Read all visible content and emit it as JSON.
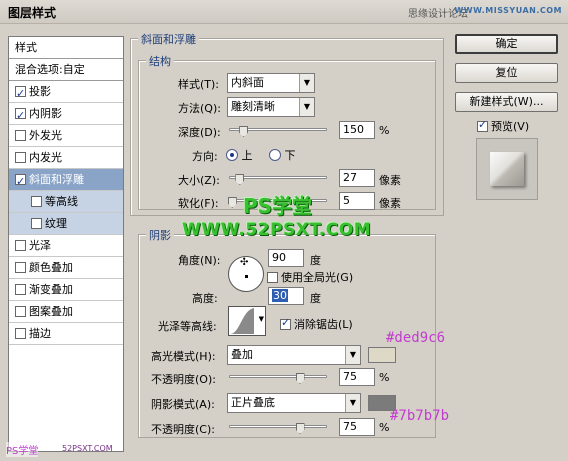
{
  "window": {
    "title": "图层样式",
    "watermark_top": "思缘设计论坛",
    "watermark_top_site": "WWW.MISSYUAN.COM"
  },
  "styles_list": {
    "header": "样式",
    "blend_options": "混合选项:自定",
    "items": [
      {
        "label": "投影",
        "checked": true
      },
      {
        "label": "内阴影",
        "checked": true
      },
      {
        "label": "外发光",
        "checked": false
      },
      {
        "label": "内发光",
        "checked": false
      },
      {
        "label": "斜面和浮雕",
        "checked": true,
        "selected": true
      },
      {
        "label": "等高线",
        "checked": false,
        "sub": true
      },
      {
        "label": "纹理",
        "checked": false,
        "sub": true
      },
      {
        "label": "光泽",
        "checked": false
      },
      {
        "label": "颜色叠加",
        "checked": false
      },
      {
        "label": "渐变叠加",
        "checked": false
      },
      {
        "label": "图案叠加",
        "checked": false
      },
      {
        "label": "描边",
        "checked": false
      }
    ]
  },
  "bevel": {
    "section_title": "斜面和浮雕",
    "structure_title": "结构",
    "style_label": "样式(T):",
    "style_value": "内斜面",
    "technique_label": "方法(Q):",
    "technique_value": "雕刻清晰",
    "depth_label": "深度(D):",
    "depth_value": "150",
    "depth_unit": "%",
    "depth_fraction": 0.15,
    "direction_label": "方向:",
    "direction_up": "上",
    "direction_down": "下",
    "size_label": "大小(Z):",
    "size_value": "27",
    "size_unit": "像素",
    "size_fraction": 0.11,
    "soften_label": "软化(F):",
    "soften_value": "5",
    "soften_unit": "像素",
    "soften_fraction": 0.03
  },
  "shading": {
    "title": "阴影",
    "angle_label": "角度(N):",
    "angle_value": "90",
    "angle_unit": "度",
    "global_light_label": "使用全局光(G)",
    "global_light_checked": false,
    "altitude_label": "高度:",
    "altitude_value": "30",
    "altitude_unit": "度",
    "gloss_contour_label": "光泽等高线:",
    "anti_alias_label": "消除锯齿(L)",
    "anti_alias_checked": true,
    "highlight_mode_label": "高光模式(H):",
    "highlight_mode_value": "叠加",
    "highlight_color": "#ded9c6",
    "highlight_opacity_label": "不透明度(O):",
    "highlight_opacity_value": "75",
    "highlight_opacity_unit": "%",
    "highlight_opacity_fraction": 0.75,
    "shadow_mode_label": "阴影模式(A):",
    "shadow_mode_value": "正片叠底",
    "shadow_color": "#7b7b7b",
    "shadow_opacity_label": "不透明度(C):",
    "shadow_opacity_value": "75",
    "shadow_opacity_unit": "%",
    "shadow_opacity_fraction": 0.75
  },
  "buttons": {
    "ok": "确定",
    "reset": "复位",
    "new_style": "新建样式(W)...",
    "preview_label": "预览(V)",
    "preview_checked": true
  },
  "annotations": {
    "highlight_hex": "#ded9c6",
    "shadow_hex": "#7b7b7b"
  },
  "watermarks": {
    "ps_center": "PS学堂",
    "site_center": "WWW.52PSXT.COM",
    "ps_bottom": "PS学堂",
    "site_bottom": "52PSXT.COM"
  }
}
